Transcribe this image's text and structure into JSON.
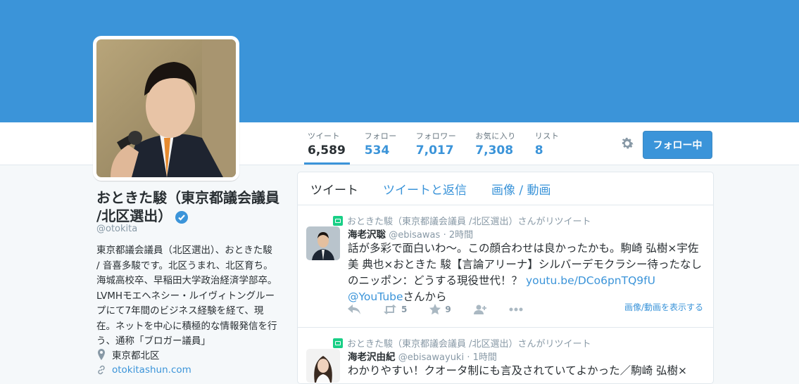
{
  "profile": {
    "name": "おときた駿（東京都議会議員 /北区選出）",
    "handle": "@otokita",
    "bio": "東京都議会議員（北区選出）、おときた駿 / 音喜多駿です。北区うまれ、北区育ち。海城高校卒、早稲田大学政治経済学部卒。LVMHモエヘネシー・ルイヴィトングループにて7年間のビジネス経験を経て、現在。ネットを中心に積極的な情報発信を行う、通称「ブロガー議員」",
    "location": "東京都北区",
    "url": "otokitashun.com"
  },
  "stats": [
    {
      "label": "ツイート",
      "value": "6,589"
    },
    {
      "label": "フォロー",
      "value": "534"
    },
    {
      "label": "フォロワー",
      "value": "7,017"
    },
    {
      "label": "お気に入り",
      "value": "7,308"
    },
    {
      "label": "リスト",
      "value": "8"
    }
  ],
  "follow_button": "フォロー中",
  "tabs": [
    "ツイート",
    "ツイートと返信",
    "画像 / 動画"
  ],
  "tweets": [
    {
      "retweet_context": "おときた駿（東京都議会議員 /北区選出）さんがリツイート",
      "author": "海老沢聡",
      "handle": "@ebisawas",
      "time": "· 2時間",
      "text": "話が多彩で面白いわ〜。この顔合わせは良かったかも。駒崎 弘樹×宇佐美 典也×おときた 駿【言論アリーナ】シルバーデモクラシー待ったなしのニッポン：どうする現役世代！？ ",
      "link": "youtu.be/DCo6pnTQ9fU",
      "mention": "@YouTube",
      "suffix": "さんから",
      "retweets": "5",
      "favorites": "9",
      "media_link": "画像/動画を表示する"
    },
    {
      "retweet_context": "おときた駿（東京都議会議員 /北区選出）さんがリツイート",
      "author": "海老沢由紀",
      "handle": "@ebisawayuki",
      "time": "· 1時間",
      "text": "わかりやすい！クオータ制にも言及されていてよかった／駒崎 弘樹×"
    }
  ],
  "colors": {
    "banner": "#3b94d9",
    "accent": "#3b94d9",
    "retweet": "#19cf86"
  }
}
